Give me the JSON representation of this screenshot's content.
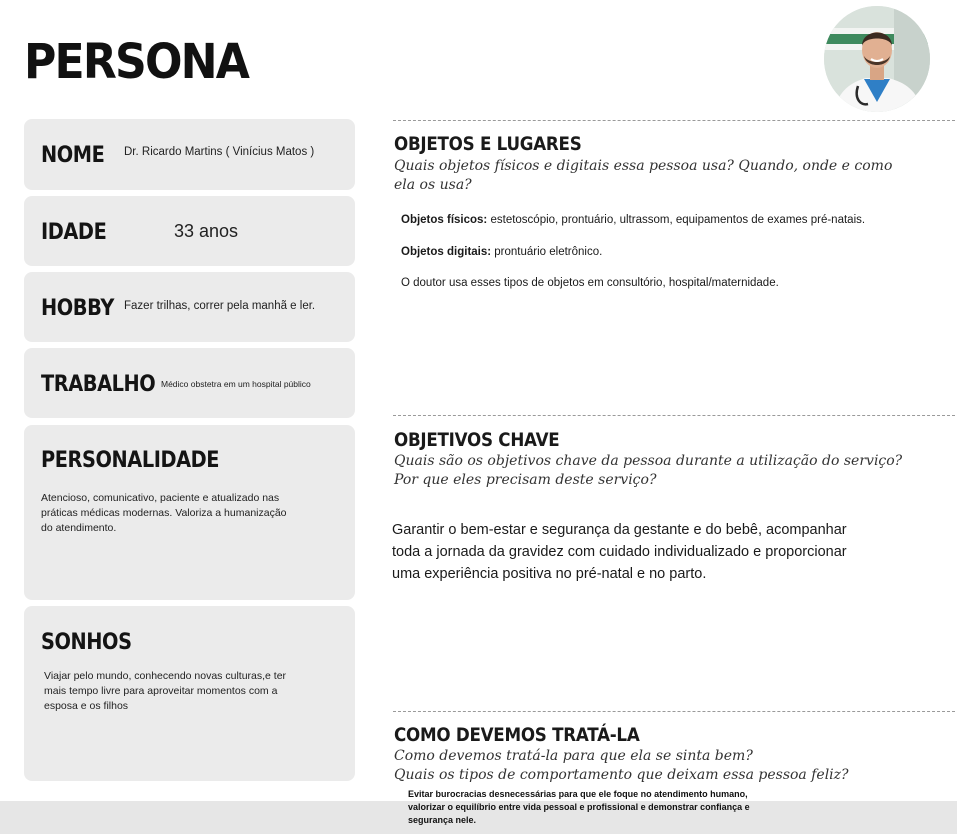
{
  "title": "PERSONA",
  "cards": {
    "nome": {
      "label": "NOME",
      "value": "Dr. Ricardo Martins ( Vinícius Matos )"
    },
    "idade": {
      "label": "IDADE",
      "value": "33 anos"
    },
    "hobby": {
      "label": "HOBBY",
      "value": "Fazer trilhas, correr pela manhã e ler."
    },
    "trabalho": {
      "label": "TRABALHO",
      "value": "Médico obstetra em um hospital público"
    },
    "personalidade": {
      "label": "PERSONALIDADE",
      "lines": [
        "Atencioso, comunicativo, paciente e atualizado nas",
        "práticas médicas modernas. Valoriza a humanização",
        "do atendimento."
      ]
    },
    "sonhos": {
      "label": "SONHOS",
      "lines": [
        "Viajar pelo mundo, conhecendo novas culturas,e ter",
        "mais tempo livre para aproveitar momentos com a",
        "esposa e os filhos"
      ]
    }
  },
  "sections": {
    "objetos": {
      "heading": "OBJETOS E LUGARES",
      "question_lines": [
        "Quais objetos físicos e digitais essa pessoa usa? Quando, onde e como",
        "ela os usa?"
      ],
      "fisicos_label": "Objetos físicos:",
      "fisicos_value": " estetoscópio, prontuário, ultrassom, equipamentos de exames pré-natais.",
      "digitais_label": "Objetos digitais:",
      "digitais_value": " prontuário eletrônico.",
      "local": "O doutor usa esses tipos de objetos em consultório, hospital/maternidade."
    },
    "objetivos": {
      "heading": "OBJETIVOS CHAVE",
      "question_lines": [
        "Quais são os objetivos chave da pessoa durante a utilização do serviço?",
        "Por que eles precisam deste serviço?"
      ],
      "body_lines": [
        "Garantir o bem-estar e segurança da gestante e do bebê, acompanhar",
        "toda a jornada da gravidez com cuidado individualizado e proporcionar",
        "uma experiência positiva no pré-natal e no parto."
      ]
    },
    "tratamento": {
      "heading": "COMO DEVEMOS TRATÁ-LA",
      "question_lines": [
        "Como devemos tratá-la para que ela se sinta bem?",
        "Quais os tipos de comportamento que deixam essa pessoa feliz?"
      ],
      "body_lines": [
        "Evitar burocracias desnecessárias para que ele foque no atendimento humano,",
        "valorizar o equilíbrio entre vida pessoal e profissional e demonstrar confiança e",
        "segurança  nele."
      ]
    }
  },
  "colors": {
    "card_bg": "#ebebeb",
    "footer_bg": "#e6e6e6",
    "divider": "#9a9a9a"
  },
  "icons": {
    "avatar": "doctor-portrait"
  }
}
